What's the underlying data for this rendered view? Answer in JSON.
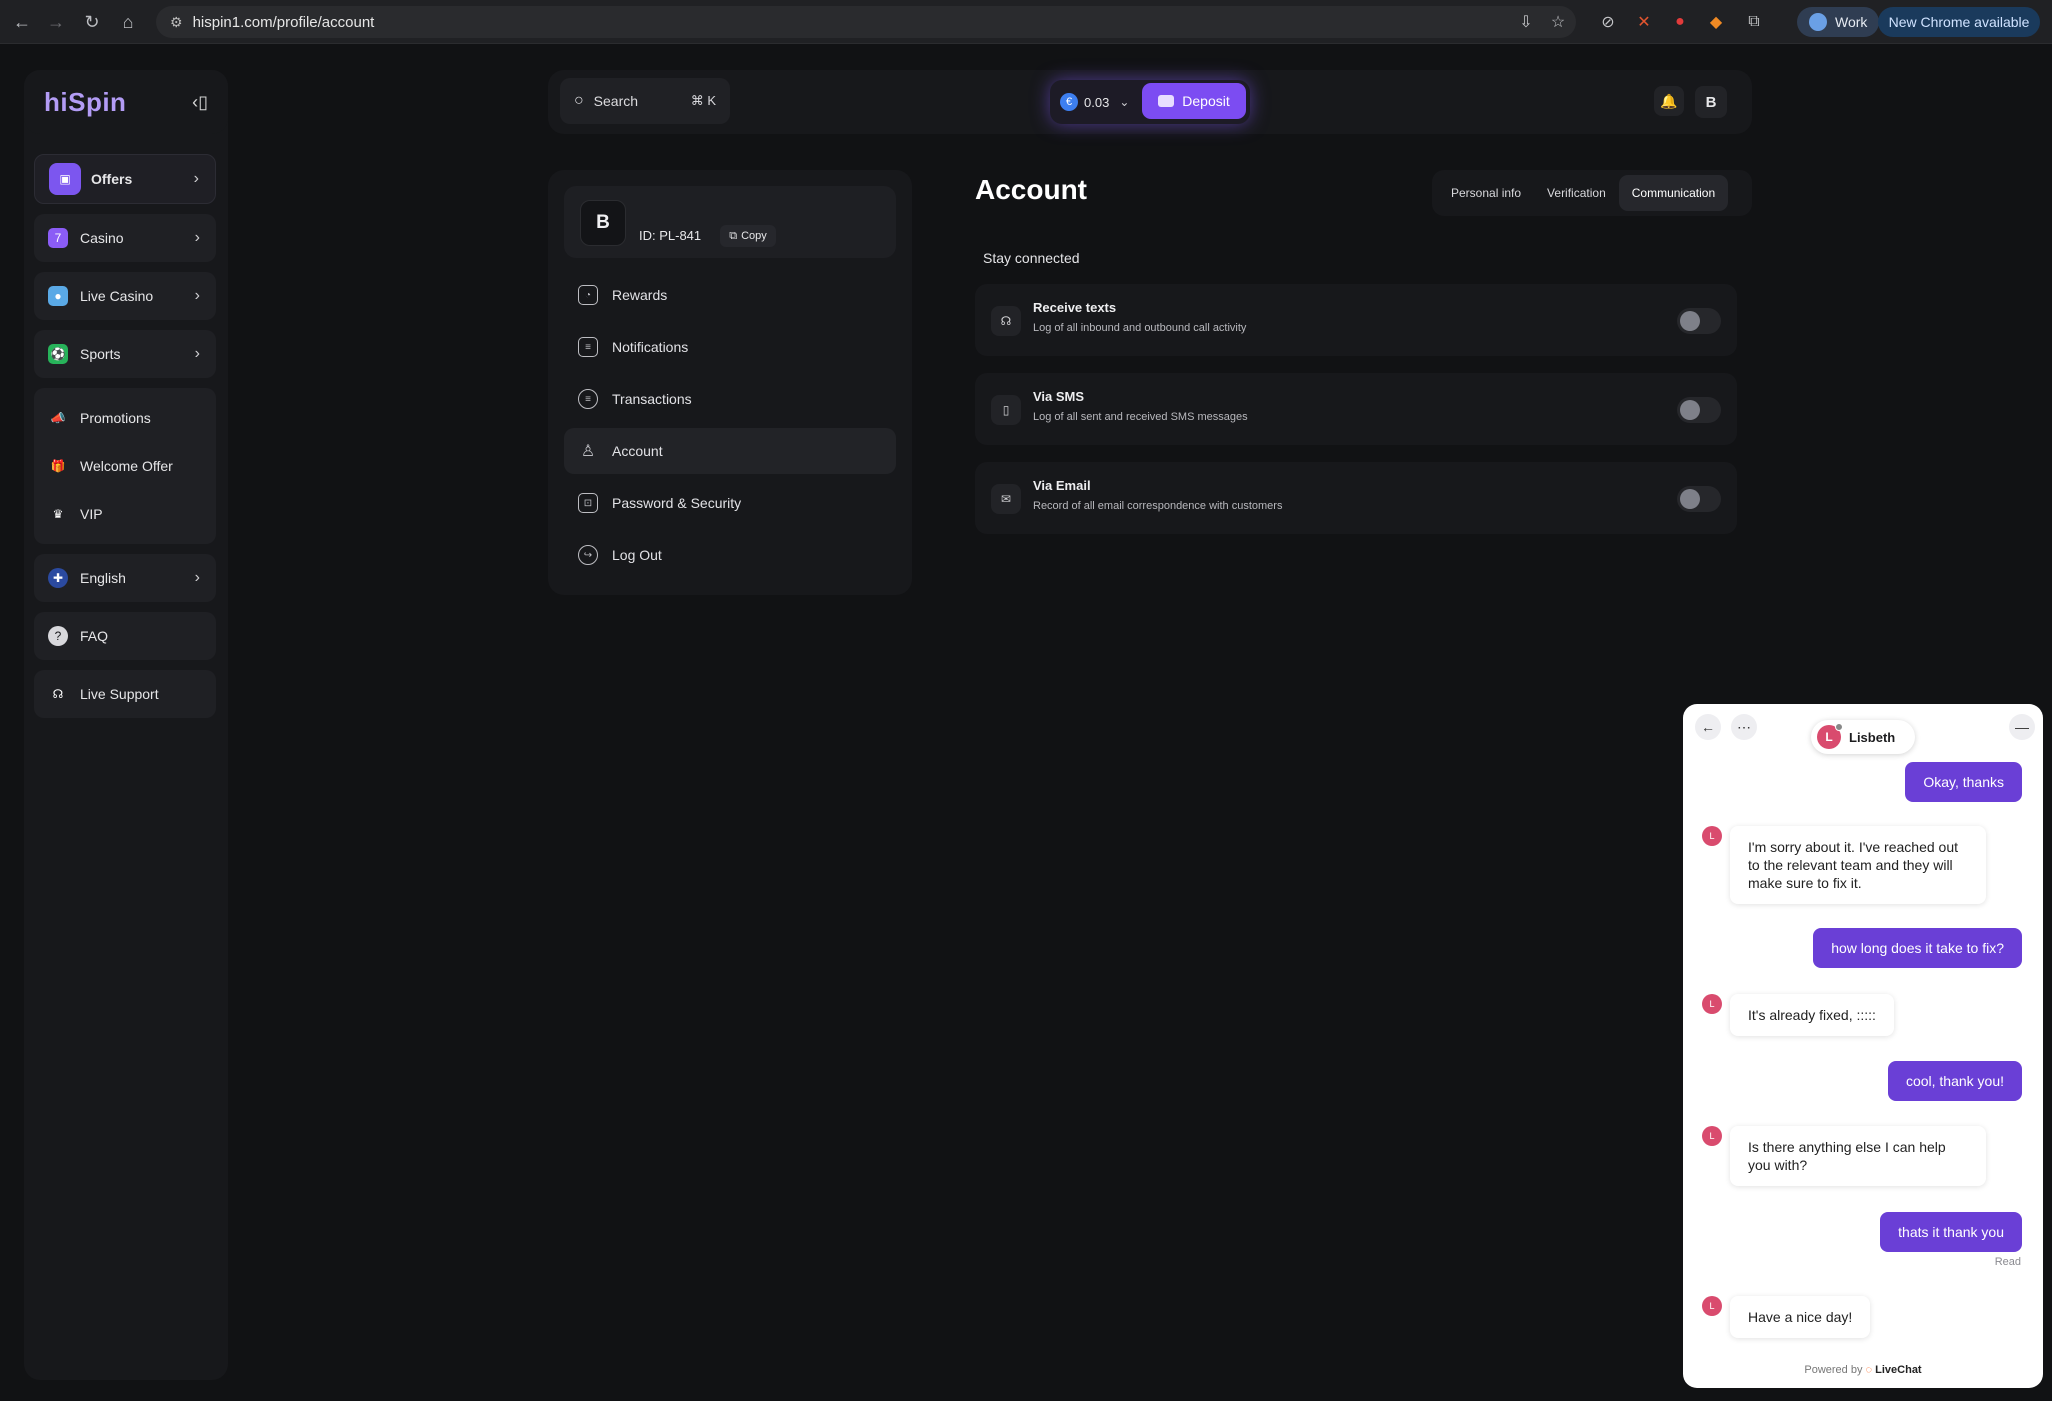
{
  "browser": {
    "url": "hispin1.com/profile/account",
    "profile_label": "Work",
    "update_label": "New Chrome available"
  },
  "brand": {
    "logo": "hiSpin",
    "accent": "#7c4cf2"
  },
  "sidebar": {
    "offers": "Offers",
    "casino": "Casino",
    "live_casino": "Live Casino",
    "sports": "Sports",
    "promotions": "Promotions",
    "welcome_offer": "Welcome Offer",
    "vip": "VIP",
    "language": "English",
    "faq": "FAQ",
    "live_support": "Live Support"
  },
  "topbar": {
    "search_label": "Search",
    "search_shortcut": "⌘ K",
    "balance": "0.03",
    "deposit_label": "Deposit",
    "avatar_initial": "B"
  },
  "profile": {
    "initial": "B",
    "id_text": "ID: PL-841",
    "copy_label": "Copy",
    "menu": {
      "rewards": "Rewards",
      "notifications": "Notifications",
      "transactions": "Transactions",
      "account": "Account",
      "password_security": "Password & Security",
      "logout": "Log Out"
    }
  },
  "account": {
    "title": "Account",
    "tabs": {
      "personal": "Personal info",
      "verification": "Verification",
      "communication": "Communication"
    },
    "section_label": "Stay connected",
    "prefs": [
      {
        "title": "Receive texts",
        "sub": "Log of all inbound and outbound call activity",
        "enabled": false
      },
      {
        "title": "Via SMS",
        "sub": "Log of all sent and received SMS messages",
        "enabled": false
      },
      {
        "title": "Via Email",
        "sub": "Record of all email correspondence with customers",
        "enabled": false
      }
    ]
  },
  "chat": {
    "agent_name": "Lisbeth",
    "agent_initial": "L",
    "messages": {
      "m1": "Okay, thanks",
      "m2": "I'm sorry about it. I've reached out to the relevant team and they will make sure to fix it.",
      "m3": "how long does it take to fix?",
      "m4": "It's already fixed, :::::",
      "m5": "cool, thank you!",
      "m6": "Is there anything else I can help you with?",
      "m7": "thats it thank you",
      "m8": "Have a nice day!"
    },
    "read_label": "Read",
    "powered_prefix": "Powered by",
    "powered_brand": "LiveChat"
  }
}
